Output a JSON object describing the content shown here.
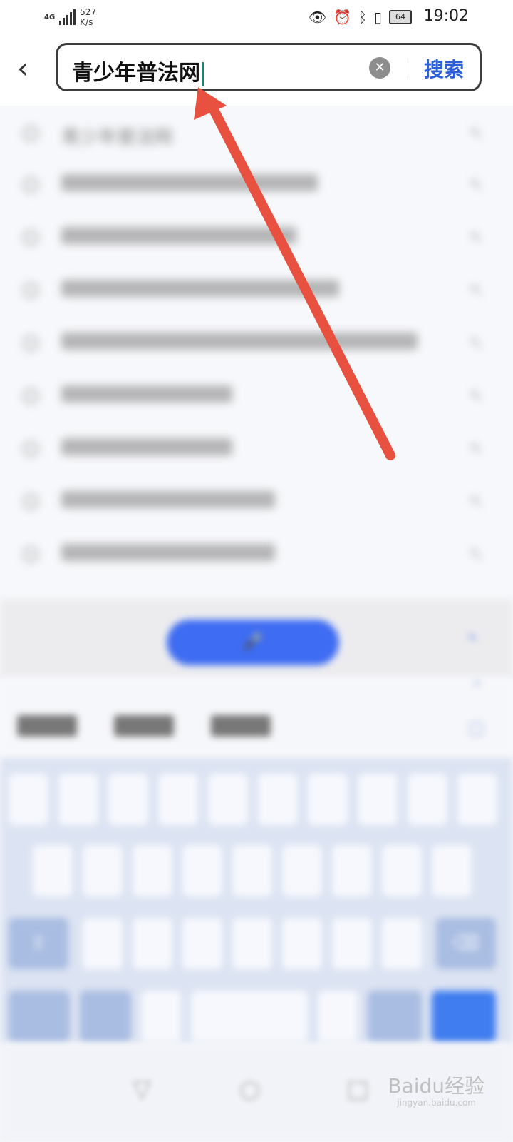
{
  "status_bar": {
    "network_type": "4G",
    "speed_value": "527",
    "speed_unit": "K/s",
    "battery": "64",
    "time": "19:02"
  },
  "search": {
    "query": "青少年普法网",
    "search_label": "搜索"
  },
  "suggestions": {
    "first": "青少年普法网"
  },
  "watermark": {
    "brand": "Baidu经验",
    "domain": "jingyan.baidu.com"
  },
  "icons": {
    "back": "chevron-left-icon",
    "clear": "close-circle-icon",
    "suggestion": "search-icon",
    "fill": "arrow-up-left-icon"
  },
  "colors": {
    "accent": "#2d5fd8",
    "annotation_arrow": "#e8513f",
    "caret": "#0a8a7a"
  }
}
